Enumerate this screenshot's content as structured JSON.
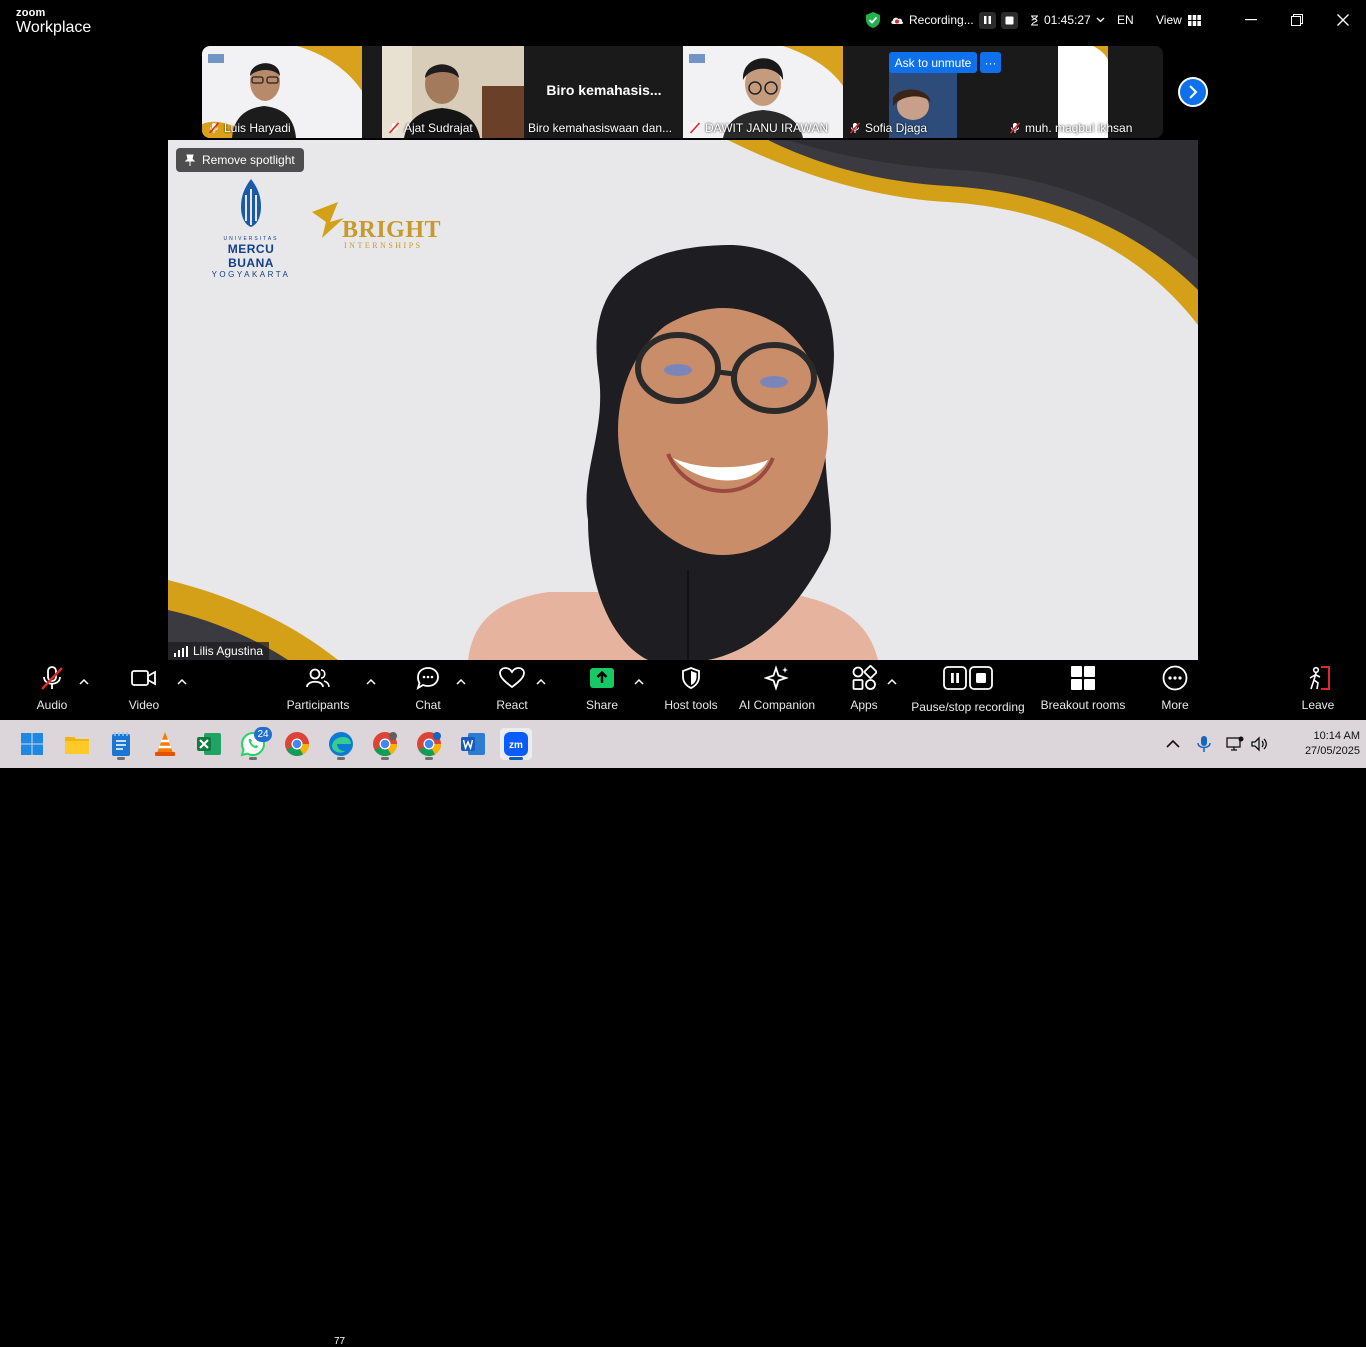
{
  "app": {
    "brand_top": "zoom",
    "brand_bottom": "Workplace"
  },
  "titlebar": {
    "recording_label": "Recording...",
    "timer": "01:45:27",
    "language": "EN",
    "view_label": "View"
  },
  "participants_strip": {
    "tiles": [
      {
        "name": "Luis Haryadi",
        "muted": true
      },
      {
        "name": "Ajat Sudrajat",
        "muted": true
      },
      {
        "name": "Biro kemahasiswaan dan...",
        "center_text": "Biro  kemahasis...",
        "muted": false
      },
      {
        "name": "DAWIT JANU IRAWAN",
        "muted": true
      },
      {
        "name": "Sofia Djaga",
        "muted": true
      },
      {
        "name": "muh. maqbul ikhsan",
        "muted": true
      }
    ],
    "ask_to_unmute_label": "Ask to unmute",
    "more_label": "···"
  },
  "main_video": {
    "remove_spotlight_label": "Remove spotlight",
    "speaker_name": "Lilis Agustina",
    "logo_univ": {
      "line1": "UNIVERSITAS",
      "line2": "MERCU BUANA",
      "line3": "YOGYAKARTA"
    },
    "logo_bright": {
      "line1": "BRIGHT",
      "line2": "INTERNSHIPS"
    }
  },
  "controls": {
    "audio": "Audio",
    "video": "Video",
    "participants": "Participants",
    "participants_count": "77",
    "chat": "Chat",
    "react": "React",
    "share": "Share",
    "host_tools": "Host tools",
    "ai_companion": "AI Companion",
    "apps": "Apps",
    "pause_stop_recording": "Pause/stop recording",
    "breakout_rooms": "Breakout rooms",
    "more": "More",
    "leave": "Leave"
  },
  "taskbar": {
    "whatsapp_badge": "24",
    "time": "10:14 AM",
    "date": "27/05/2025"
  },
  "colors": {
    "accent": "#0e71eb",
    "share_green": "#17c964",
    "muted_red": "#e02828",
    "gold": "#c89a2c",
    "shield_green": "#22b14c"
  }
}
